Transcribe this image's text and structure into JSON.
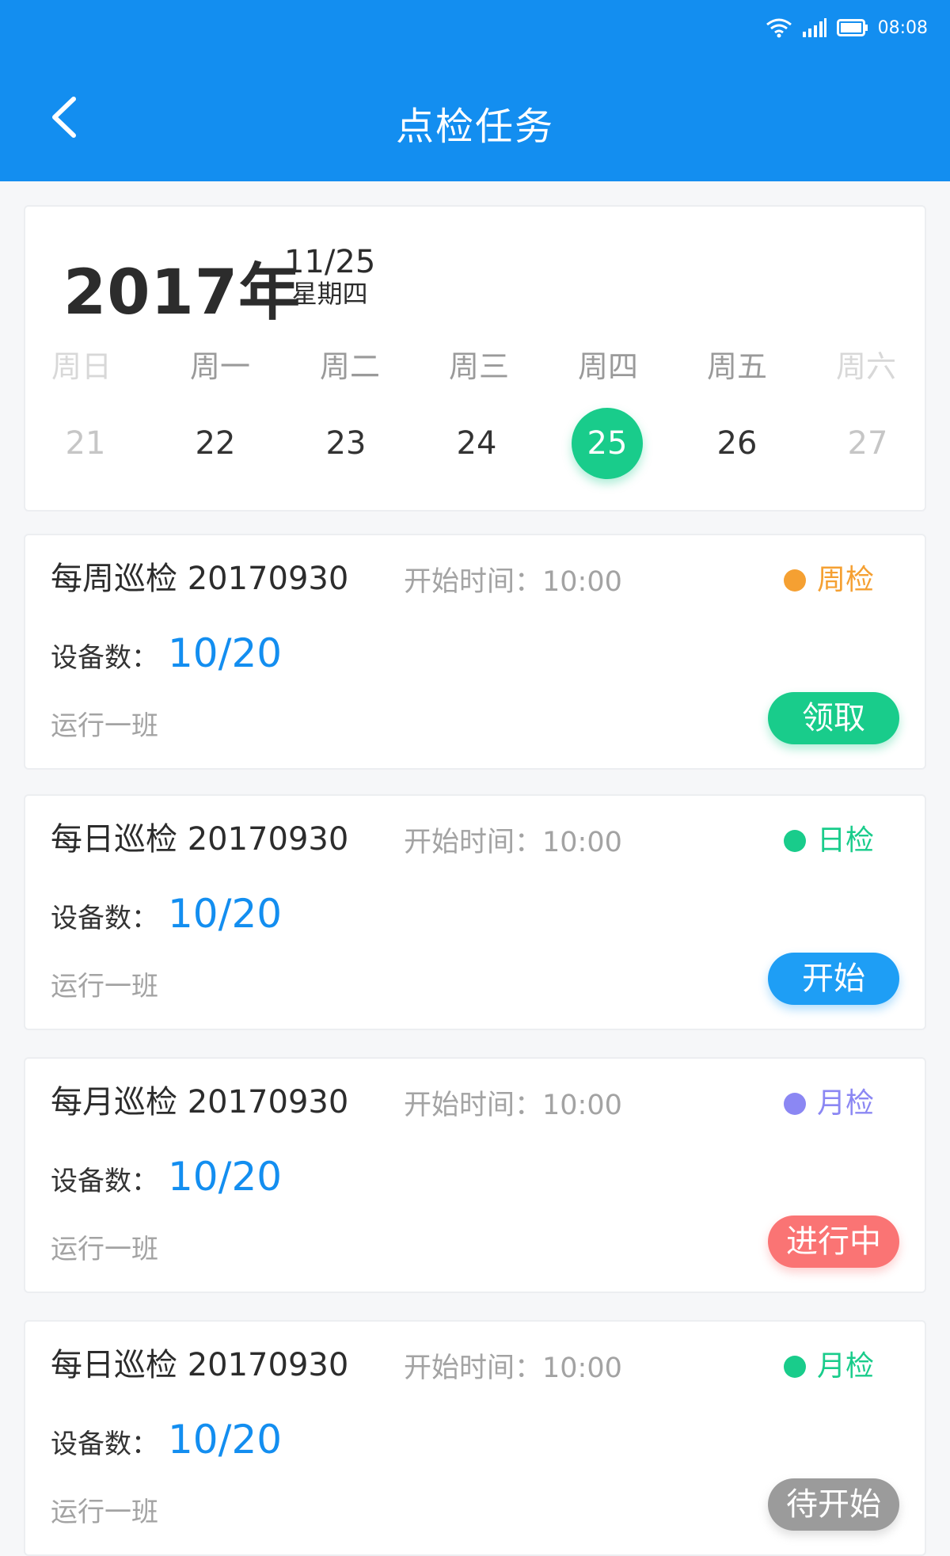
{
  "status_bar": {
    "time": "08:08"
  },
  "header": {
    "title": "点检任务"
  },
  "calendar": {
    "year": "2017年",
    "month_day": "11/25",
    "weekday": "星期四",
    "week_labels": [
      "周日",
      "周一",
      "周二",
      "周三",
      "周四",
      "周五",
      "周六"
    ],
    "days": [
      "21",
      "22",
      "23",
      "24",
      "25",
      "26",
      "27"
    ],
    "selected_index": 4
  },
  "tasks": [
    {
      "name": "每周巡检 20170930",
      "start_label": "开始时间：10:00",
      "type_label": "周检",
      "type_color": "#f5a032",
      "count_label": "设备数：",
      "count_value": "10/20",
      "team": "运行一班",
      "action_label": "领取",
      "action_color": "#19cc8b"
    },
    {
      "name": "每日巡检 20170930",
      "start_label": "开始时间：10:00",
      "type_label": "日检",
      "type_color": "#19cc8b",
      "count_label": "设备数：",
      "count_value": "10/20",
      "team": "运行一班",
      "action_label": "开始",
      "action_color": "#1e9ef5"
    },
    {
      "name": "每月巡检 20170930",
      "start_label": "开始时间：10:00",
      "type_label": "月检",
      "type_color": "#8b87f3",
      "count_label": "设备数：",
      "count_value": "10/20",
      "team": "运行一班",
      "action_label": "进行中",
      "action_color": "#fa7474"
    },
    {
      "name": "每日巡检 20170930",
      "start_label": "开始时间：10:00",
      "type_label": "月检",
      "type_color": "#19cc8b",
      "count_label": "设备数：",
      "count_value": "10/20",
      "team": "运行一班",
      "action_label": "待开始",
      "action_color": "#9b9b9b"
    }
  ]
}
